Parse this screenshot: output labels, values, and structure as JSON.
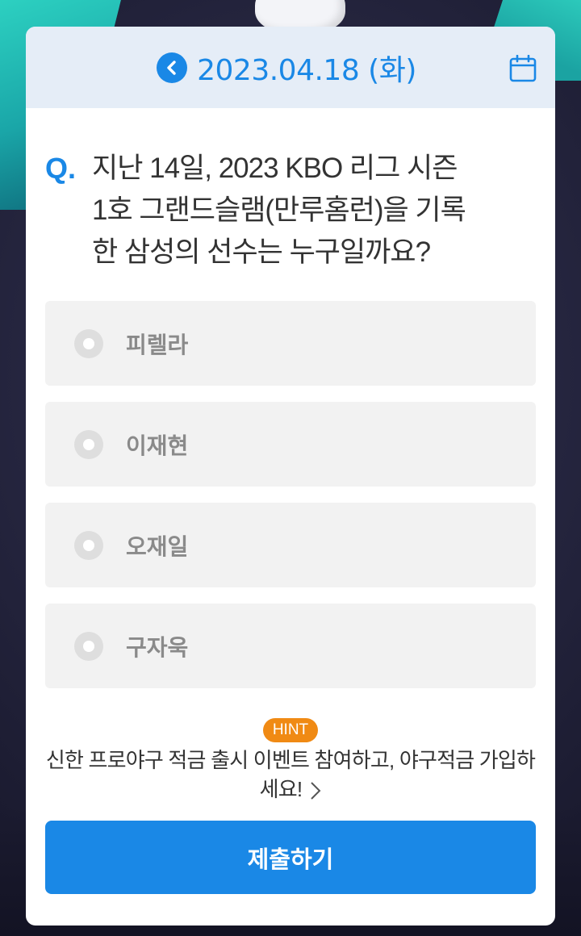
{
  "header": {
    "date": "2023.04.18 (화)",
    "prev_icon": "chevron-left-icon",
    "calendar_icon": "calendar-icon"
  },
  "quiz": {
    "q_mark": "Q.",
    "question_lines": [
      "지난 14일, 2023 KBO 리그 시즌",
      "1호 그랜드슬램(만루홈런)을 기록",
      "한 삼성의 선수는 누구일까요?"
    ],
    "options": [
      {
        "label": "피렐라"
      },
      {
        "label": "이재현"
      },
      {
        "label": "오재일"
      },
      {
        "label": "구자욱"
      }
    ]
  },
  "hint": {
    "badge": "HINT",
    "text": "신한 프로야구 적금 출시 이벤트 참여하고, 야구적금 가입하세요!"
  },
  "submit_label": "제출하기",
  "colors": {
    "accent": "#1a88e6",
    "header_bg": "#e5edf7",
    "option_bg": "#f2f2f2",
    "hint_badge": "#f08a14"
  }
}
